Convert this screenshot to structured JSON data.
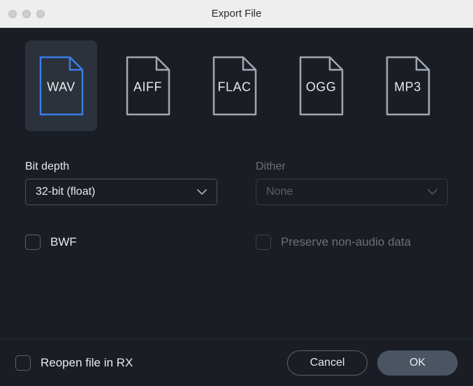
{
  "window": {
    "title": "Export File"
  },
  "formats": [
    {
      "label": "WAV",
      "selected": true,
      "strokeColor": "#3b7de9",
      "textColor": "#e8e9ea"
    },
    {
      "label": "AIFF",
      "selected": false,
      "strokeColor": "#a2a8b2",
      "textColor": "#e8e9ea"
    },
    {
      "label": "FLAC",
      "selected": false,
      "strokeColor": "#a2a8b2",
      "textColor": "#e8e9ea"
    },
    {
      "label": "OGG",
      "selected": false,
      "strokeColor": "#a2a8b2",
      "textColor": "#e8e9ea"
    },
    {
      "label": "MP3",
      "selected": false,
      "strokeColor": "#a2a8b2",
      "textColor": "#e8e9ea"
    }
  ],
  "settings": {
    "bit_depth": {
      "label": "Bit depth",
      "value": "32-bit (float)",
      "disabled": false
    },
    "dither": {
      "label": "Dither",
      "value": "None",
      "disabled": true
    }
  },
  "checks": {
    "bwf": {
      "label": "BWF",
      "checked": false,
      "disabled": false
    },
    "preserve": {
      "label": "Preserve non-audio data",
      "checked": false,
      "disabled": true
    }
  },
  "footer": {
    "reopen": {
      "label": "Reopen file in RX",
      "checked": false
    },
    "cancel": "Cancel",
    "ok": "OK"
  }
}
